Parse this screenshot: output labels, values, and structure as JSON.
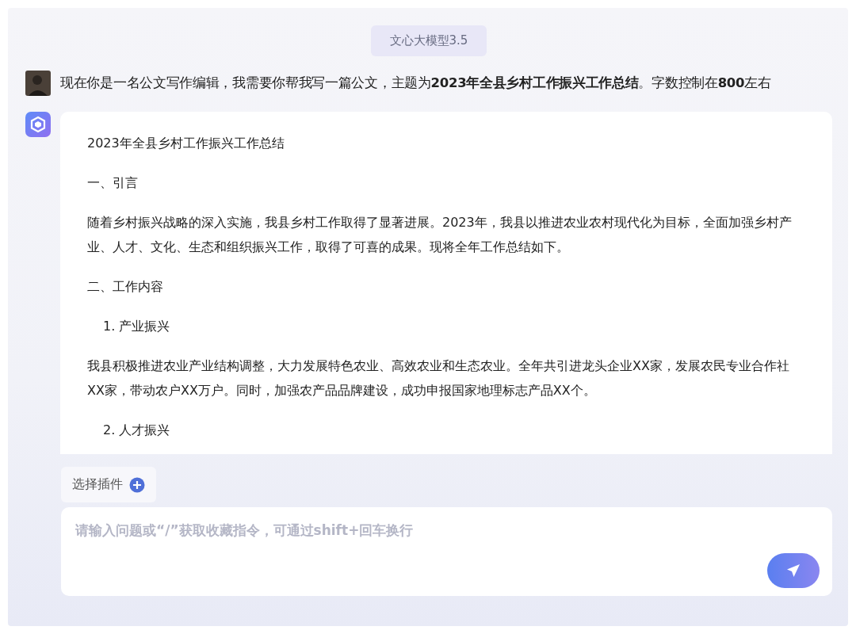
{
  "model_badge": "文心大模型3.5",
  "user_message": {
    "text": "现在你是一名公文写作编辑，我需要你帮我写一篇公文，主题为**2023年全县乡村工作振兴工作总结**。字数控制在**800**左右"
  },
  "response": {
    "paragraphs": [
      {
        "kind": "title",
        "text": "2023年全县乡村工作振兴工作总结"
      },
      {
        "kind": "heading",
        "text": "一、引言"
      },
      {
        "kind": "paragraph",
        "text": "随着乡村振兴战略的深入实施，我县乡村工作取得了显著进展。2023年，我县以推进农业农村现代化为目标，全面加强乡村产业、人才、文化、生态和组织振兴工作，取得了可喜的成果。现将全年工作总结如下。"
      },
      {
        "kind": "heading",
        "text": "二、工作内容"
      },
      {
        "kind": "item",
        "text": "1. 产业振兴"
      },
      {
        "kind": "paragraph",
        "text": "我县积极推进农业产业结构调整，大力发展特色农业、高效农业和生态农业。全年共引进龙头企业XX家，发展农民专业合作社XX家，带动农户XX万户。同时，加强农产品品牌建设，成功申报国家地理标志产品XX个。"
      },
      {
        "kind": "item",
        "text": "2. 人才振兴"
      }
    ]
  },
  "plugin_button": {
    "label": "选择插件"
  },
  "input": {
    "placeholder": "请输入问题或“/”获取收藏指令，可通过shift+回车换行"
  }
}
